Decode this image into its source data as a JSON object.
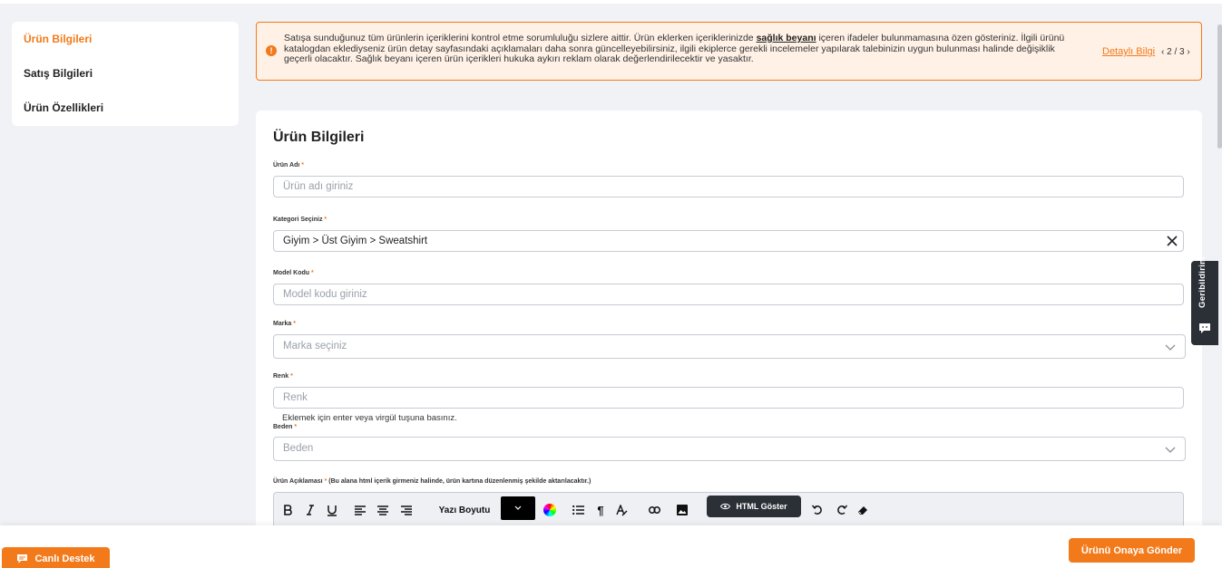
{
  "sidebar": {
    "items": [
      {
        "label": "Ürün Bilgileri",
        "active": true
      },
      {
        "label": "Satış Bilgileri",
        "active": false
      },
      {
        "label": "Ürün Özellikleri",
        "active": false
      }
    ]
  },
  "banner": {
    "text_before": "Satışa sunduğunuz tüm ürünlerin içeriklerini kontrol etme sorumluluğu sizlere aittir. Ürün eklerken içeriklerinizde ",
    "text_bold": "sağlık beyanı",
    "text_after": " içeren ifadeler bulunmamasına özen gösteriniz. İlgili ürünü katalogdan eklediyseniz ürün detay sayfasındaki açıklamaları daha sonra güncelleyebilirsiniz, ilgili ekiplerce gerekli incelemeler yapılarak talebinizin uygun bulunması halinde değişiklik geçerli olacaktır. Sağlık beyanı içeren ürün içerikleri hukuka aykırı reklam olarak değerlendirilecektir ve yasaktır.",
    "detail_link": "Detaylı Bilgi",
    "pager": "2 / 3"
  },
  "form": {
    "title": "Ürün Bilgileri",
    "product_name": {
      "label": "Ürün Adı",
      "placeholder": "Ürün adı giriniz"
    },
    "category": {
      "label": "Kategori Seçiniz",
      "value": "Giyim > Üst Giyim > Sweatshirt"
    },
    "model_code": {
      "label": "Model Kodu",
      "placeholder": "Model kodu giriniz"
    },
    "brand": {
      "label": "Marka",
      "placeholder": "Marka seçiniz"
    },
    "color": {
      "label": "Renk",
      "placeholder": "Renk",
      "hint": "Eklemek için enter veya virgül tuşuna basınız."
    },
    "size": {
      "label": "Beden",
      "placeholder": "Beden"
    },
    "description": {
      "label": "Ürün Açıklaması",
      "note": " (Bu alana html içerik girmeniz halinde, ürün kartına düzenlenmiş şekilde aktarılacaktır.)"
    },
    "required_mark": "*"
  },
  "editor": {
    "font_size_label": "Yazı Boyutu",
    "html_button_label": "HTML Göster"
  },
  "feedback_tab": "Geribildirim",
  "bottom": {
    "live_support": "Canlı Destek",
    "submit": "Ürünü Onaya Gönder"
  },
  "colors": {
    "accent": "#f27a1a",
    "dark": "#2b2f36"
  }
}
